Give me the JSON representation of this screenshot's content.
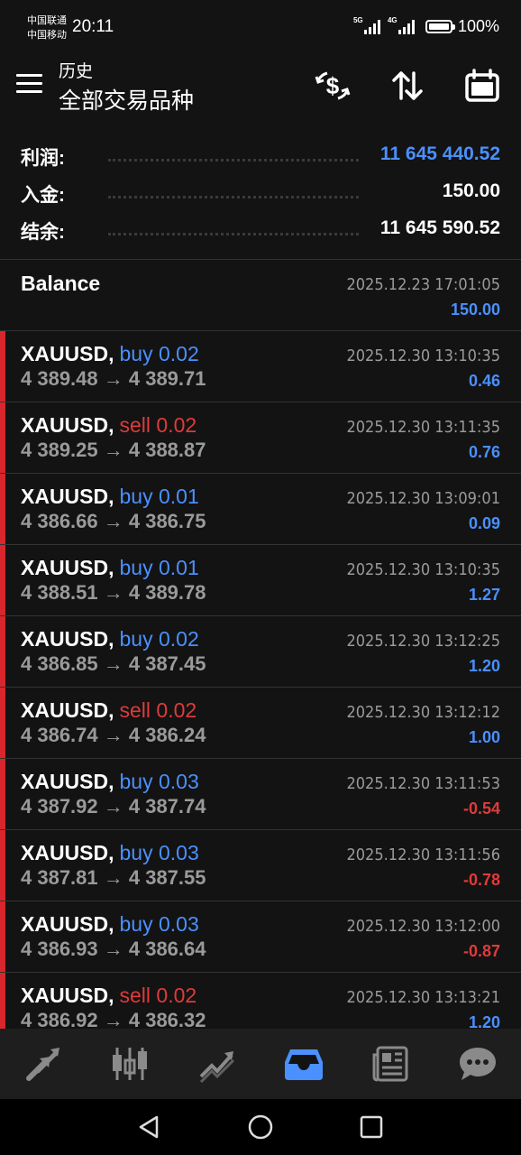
{
  "status": {
    "carrier1": "中国联通",
    "carrier2": "中国移动",
    "time": "20:11",
    "net1": "5G",
    "net2": "4G",
    "battery": "100%",
    "battery_level": 1.0
  },
  "header": {
    "subtitle": "历史",
    "title": "全部交易品种"
  },
  "summary": [
    {
      "label": "利润:",
      "value": "11 645 440.52",
      "color": "#4a90ff"
    },
    {
      "label": "入金:",
      "value": "150.00",
      "color": "#ffffff"
    },
    {
      "label": "结余:",
      "value": "11 645 590.52",
      "color": "#ffffff"
    }
  ],
  "balance": {
    "title": "Balance",
    "time": "2025.12.23 17:01:05",
    "amount": "150.00"
  },
  "trades": [
    {
      "symbol": "XAUUSD,",
      "direction": "buy 0.02",
      "prices": "4 389.48 → 4 389.71",
      "time": "2025.12.30 13:10:35",
      "profit": "0.46"
    },
    {
      "symbol": "XAUUSD,",
      "direction": "sell 0.02",
      "prices": "4 389.25 → 4 388.87",
      "time": "2025.12.30 13:11:35",
      "profit": "0.76"
    },
    {
      "symbol": "XAUUSD,",
      "direction": "buy 0.01",
      "prices": "4 386.66 → 4 386.75",
      "time": "2025.12.30 13:09:01",
      "profit": "0.09"
    },
    {
      "symbol": "XAUUSD,",
      "direction": "buy 0.01",
      "prices": "4 388.51 → 4 389.78",
      "time": "2025.12.30 13:10:35",
      "profit": "1.27"
    },
    {
      "symbol": "XAUUSD,",
      "direction": "buy 0.02",
      "prices": "4 386.85 → 4 387.45",
      "time": "2025.12.30 13:12:25",
      "profit": "1.20"
    },
    {
      "symbol": "XAUUSD,",
      "direction": "sell 0.02",
      "prices": "4 386.74 → 4 386.24",
      "time": "2025.12.30 13:12:12",
      "profit": "1.00"
    },
    {
      "symbol": "XAUUSD,",
      "direction": "buy 0.03",
      "prices": "4 387.92 → 4 387.74",
      "time": "2025.12.30 13:11:53",
      "profit": "-0.54"
    },
    {
      "symbol": "XAUUSD,",
      "direction": "buy 0.03",
      "prices": "4 387.81 → 4 387.55",
      "time": "2025.12.30 13:11:56",
      "profit": "-0.78"
    },
    {
      "symbol": "XAUUSD,",
      "direction": "buy 0.03",
      "prices": "4 386.93 → 4 386.64",
      "time": "2025.12.30 13:12:00",
      "profit": "-0.87"
    },
    {
      "symbol": "XAUUSD,",
      "direction": "sell 0.02",
      "prices": "4 386.92 → 4 386.32",
      "time": "2025.12.30 13:13:21",
      "profit": "1.20"
    }
  ],
  "bottom_nav": [
    {
      "icon": "quotes-arrows-icon",
      "active": false
    },
    {
      "icon": "candlestick-chart-icon",
      "active": false
    },
    {
      "icon": "trade-trend-icon",
      "active": false
    },
    {
      "icon": "history-inbox-icon",
      "active": true
    },
    {
      "icon": "news-icon",
      "active": false
    },
    {
      "icon": "chat-icon",
      "active": false
    }
  ],
  "colors": {
    "accent": "#4a90ff",
    "loss": "#e03a3a",
    "row_marker": "#d9262c",
    "muted": "#9a9a9a",
    "background": "#131313"
  }
}
